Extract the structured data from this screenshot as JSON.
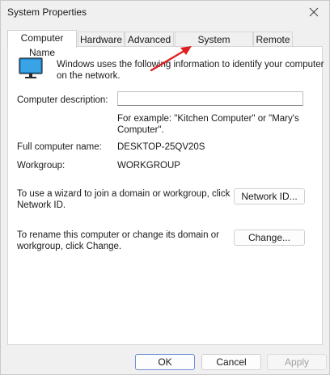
{
  "window": {
    "title": "System Properties"
  },
  "tabs": [
    {
      "label": "Computer Name"
    },
    {
      "label": "Hardware"
    },
    {
      "label": "Advanced"
    },
    {
      "label": "System Protection"
    },
    {
      "label": "Remote"
    }
  ],
  "intro": {
    "line1": "Windows uses the following information to identify your computer",
    "line2": "on the network."
  },
  "description": {
    "label": "Computer description:",
    "value": "",
    "hint_line1": "For example: \"Kitchen Computer\" or \"Mary's",
    "hint_line2": "Computer\"."
  },
  "full_name": {
    "label": "Full computer name:",
    "value": "DESKTOP-25QV20S"
  },
  "workgroup": {
    "label": "Workgroup:",
    "value": "WORKGROUP"
  },
  "network_id": {
    "line1": "To use a wizard to join a domain or workgroup, click",
    "line2": "Network ID.",
    "button": "Network ID..."
  },
  "rename": {
    "line1": "To rename this computer or change its domain or",
    "line2": "workgroup, click Change.",
    "button": "Change..."
  },
  "footer": {
    "ok": "OK",
    "cancel": "Cancel",
    "apply": "Apply"
  },
  "colors": {
    "arrow": "#e02020",
    "monitor": "#1e8ad6"
  },
  "icons": {
    "close": "close-icon",
    "computer": "computer-monitor-icon",
    "arrow": "red-arrow-annotation"
  }
}
